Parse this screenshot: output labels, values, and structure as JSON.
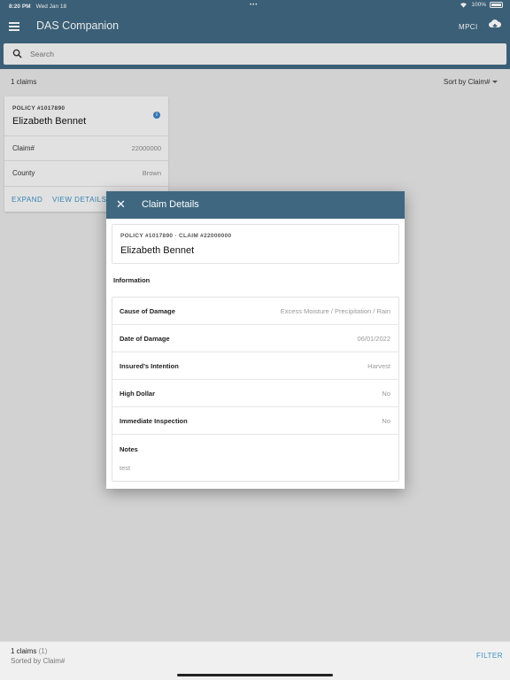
{
  "status_bar": {
    "time": "8:20 PM",
    "date": "Wed Jan 18",
    "battery": "100%"
  },
  "app_bar": {
    "title": "DAS Companion",
    "program": "MPCI",
    "menu_icon": "menu-icon",
    "cloud_icon": "cloud-upload-icon"
  },
  "search": {
    "placeholder": "Search",
    "value": ""
  },
  "list": {
    "count_label": "1 claims",
    "sort_label": "Sort by Claim#",
    "card": {
      "policy": "POLICY #1017890",
      "name": "Elizabeth Bennet",
      "rows": [
        {
          "label": "Claim#",
          "value": "22000000"
        },
        {
          "label": "County",
          "value": "Brown"
        }
      ],
      "actions": {
        "expand": "EXPAND",
        "view_details": "VIEW DETAILS"
      }
    }
  },
  "modal": {
    "title": "Claim Details",
    "policy_line": "POLICY #1017890 · CLAIM #22000000",
    "name": "Elizabeth Bennet",
    "section_heading": "Information",
    "details": [
      {
        "label": "Cause of Damage",
        "value": "Excess Moisture / Precipitation / Rain"
      },
      {
        "label": "Date of Damage",
        "value": "06/01/2022"
      },
      {
        "label": "Insured's Intention",
        "value": "Harvest"
      },
      {
        "label": "High Dollar",
        "value": "No"
      },
      {
        "label": "Immediate Inspection",
        "value": "No"
      }
    ],
    "notes_label": "Notes",
    "notes_value": "test"
  },
  "bottom_bar": {
    "count": "1 claims",
    "count_suffix": "(1)",
    "sorted": "Sorted by Claim#",
    "filter_label": "FILTER"
  },
  "colors": {
    "primary": "#3f6880",
    "accent": "#3a8ec3"
  }
}
